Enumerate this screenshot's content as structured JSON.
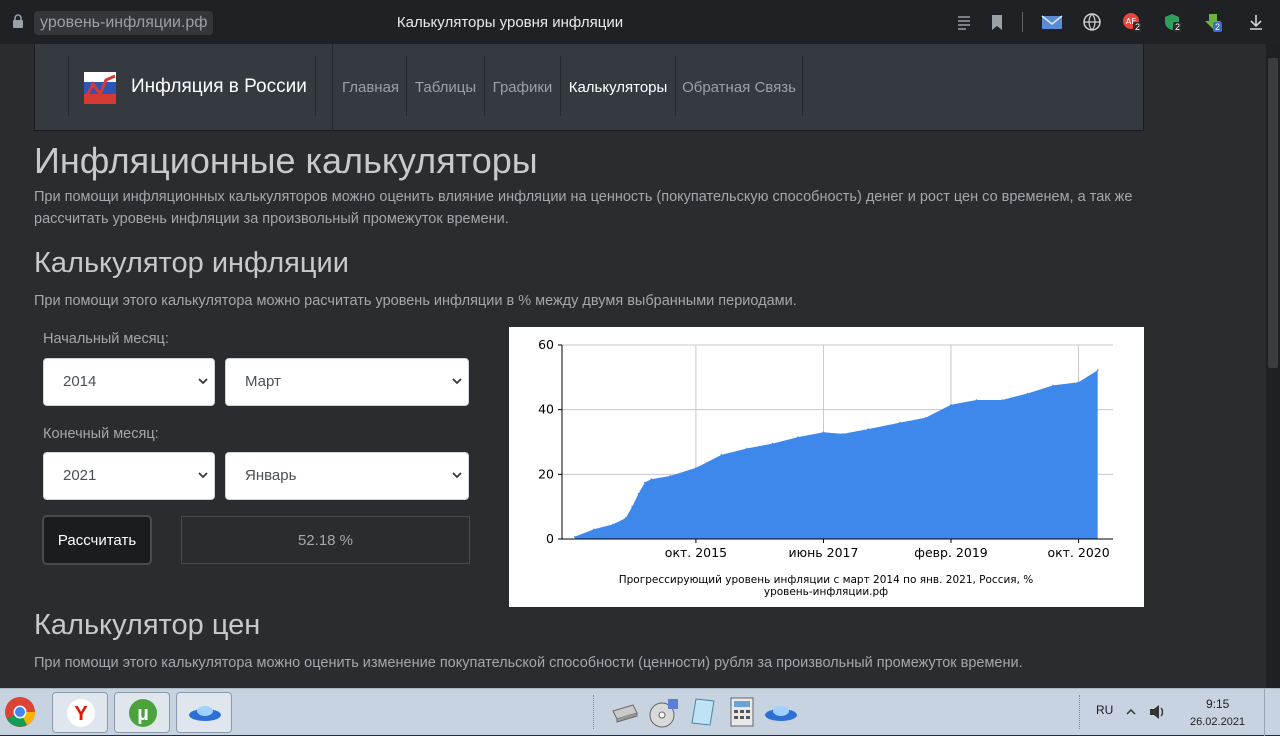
{
  "browser": {
    "url": "уровень-инфляции.рф",
    "title": "Калькуляторы уровня инфляции",
    "badges": {
      "ae": "2",
      "shield": "2",
      "download_ext": "2"
    }
  },
  "site": {
    "brand": "Инфляция в России",
    "nav": [
      {
        "label": "Главная",
        "active": false
      },
      {
        "label": "Таблицы",
        "active": false
      },
      {
        "label": "Графики",
        "active": false
      },
      {
        "label": "Калькуляторы",
        "active": true
      },
      {
        "label": "Обратная Связь",
        "active": false
      }
    ]
  },
  "content": {
    "h1": "Инфляционные калькуляторы",
    "intro": "При помощи инфляционных калькуляторов можно оценить влияние инфляции на ценность (покупательскую способность) денег и рост цен со временем, а так же рассчитать уровень инфляции за произвольный промежуток времени.",
    "inflation_calc": {
      "title": "Калькулятор инфляции",
      "desc": "При помощи этого калькулятора можно расчитать уровень инфляции в % между двумя выбранными периодами.",
      "start_label": "Начальный месяц:",
      "start_year": "2014",
      "start_month": "Март",
      "end_label": "Конечный месяц:",
      "end_year": "2021",
      "end_month": "Январь",
      "button": "Рассчитать",
      "result": "52.18 %"
    },
    "price_calc": {
      "title": "Калькулятор цен",
      "desc": "При помощи этого калькулятора можно оценить изменение покупательской способности (ценности) рубля за произвольный промежуток времени."
    }
  },
  "chart_data": {
    "type": "area",
    "caption_line1": "Прогрессирующий уровень инфляции с март 2014 по янв. 2021, Россия, %",
    "caption_line2": "уровень-инфляции.рф",
    "x_tick_labels": [
      "окт. 2015",
      "июнь 2017",
      "февр. 2019",
      "окт. 2020"
    ],
    "y_tick_labels": [
      "0",
      "20",
      "40",
      "60"
    ],
    "ylim": [
      0,
      60
    ],
    "grid": true,
    "color": "#3d88ea",
    "x": [
      "2014-03",
      "2014-06",
      "2014-09",
      "2014-11",
      "2014-12",
      "2015-01",
      "2015-02",
      "2015-03",
      "2015-06",
      "2015-10",
      "2016-02",
      "2016-06",
      "2016-10",
      "2017-02",
      "2017-06",
      "2017-09",
      "2018-01",
      "2018-06",
      "2018-10",
      "2019-02",
      "2019-06",
      "2019-10",
      "2020-02",
      "2020-06",
      "2020-10",
      "2021-01"
    ],
    "y": [
      0.7,
      3.0,
      4.5,
      6.5,
      10.0,
      14.0,
      17.5,
      18.5,
      19.5,
      22.0,
      26.0,
      28.0,
      29.5,
      31.5,
      33.0,
      32.5,
      34.0,
      36.0,
      37.5,
      41.5,
      43.0,
      43.0,
      45.0,
      47.5,
      48.5,
      52.2
    ]
  },
  "taskbar": {
    "lang": "RU",
    "time": "9:15",
    "date": "26.02.2021"
  }
}
